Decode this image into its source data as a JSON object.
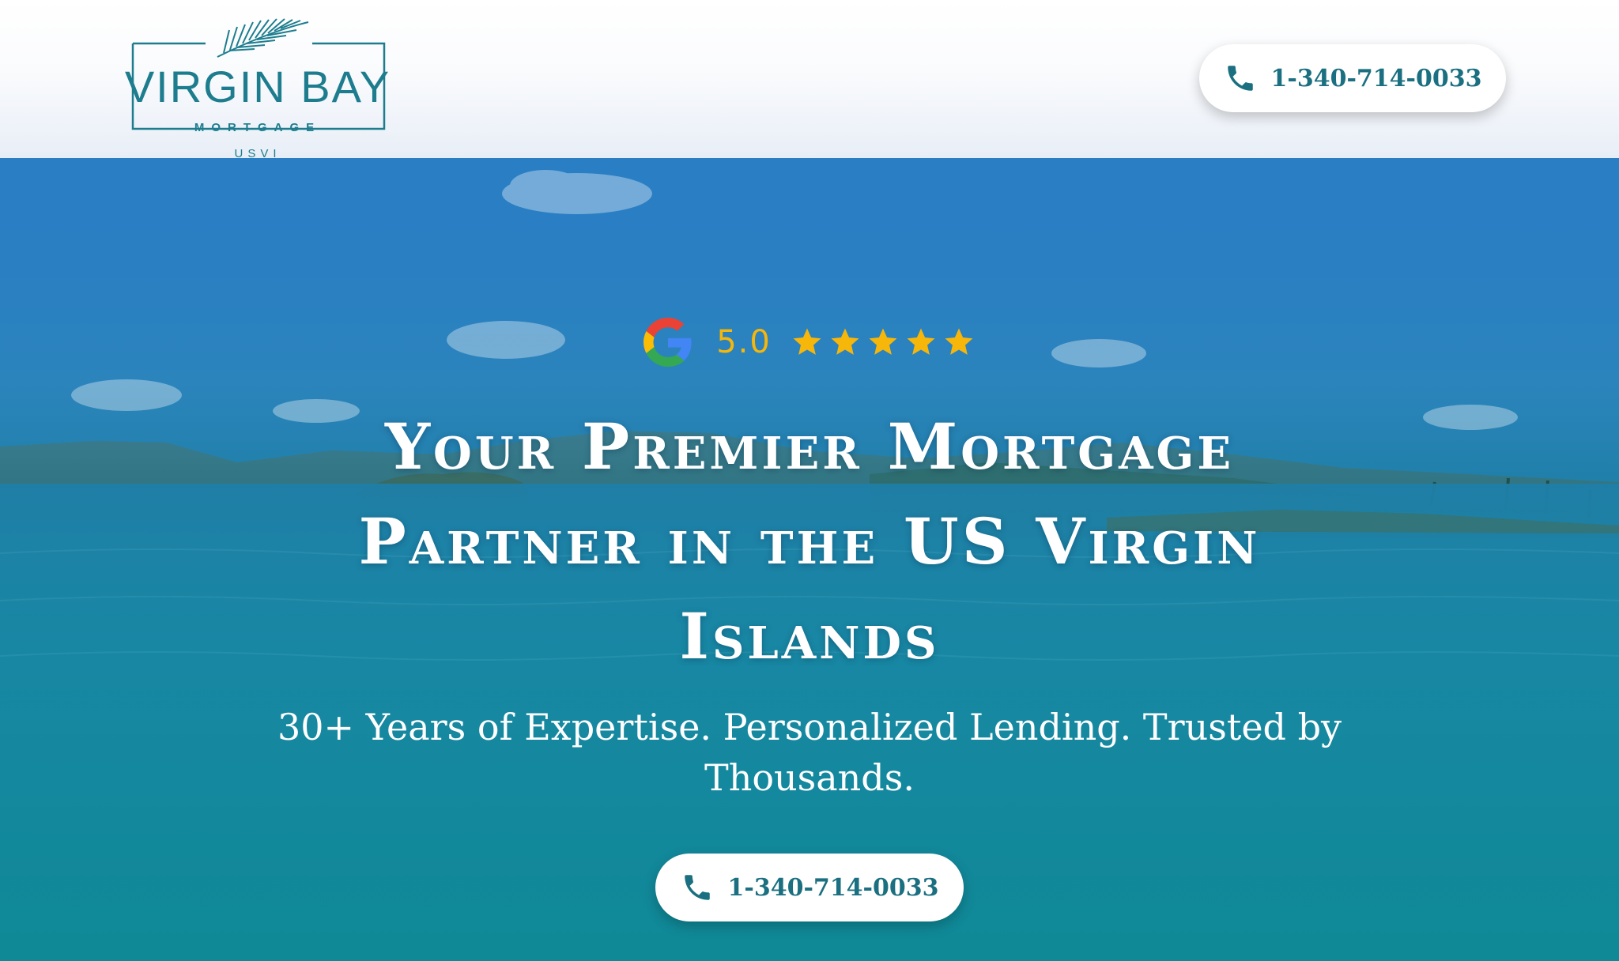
{
  "header": {
    "logo": {
      "name": "VIRGIN BAY",
      "subtitle": "MORTGAGE",
      "tagline": "USVI",
      "icon": "palm-leaf-icon"
    },
    "phone_button": {
      "label": "1-340-714-0033",
      "icon": "phone-icon"
    }
  },
  "hero": {
    "rating": {
      "provider_icon": "google-icon",
      "score": "5.0",
      "stars": 5,
      "star_icon": "star-icon"
    },
    "title_lines": [
      "Your Premier Mortgage",
      "Partner in the US Virgin",
      "Islands"
    ],
    "subtitle_lines": [
      "30+ Years of Expertise. Personalized Lending. Trusted by",
      "Thousands."
    ],
    "phone_button": {
      "label": "1-340-714-0033",
      "icon": "phone-icon"
    }
  },
  "colors": {
    "brand_teal": "#1d7d8e",
    "button_text": "#1a6f80",
    "star_gold": "#f6b60a",
    "sky_blue": "#2a7cc7",
    "sea_teal": "#12899c"
  }
}
